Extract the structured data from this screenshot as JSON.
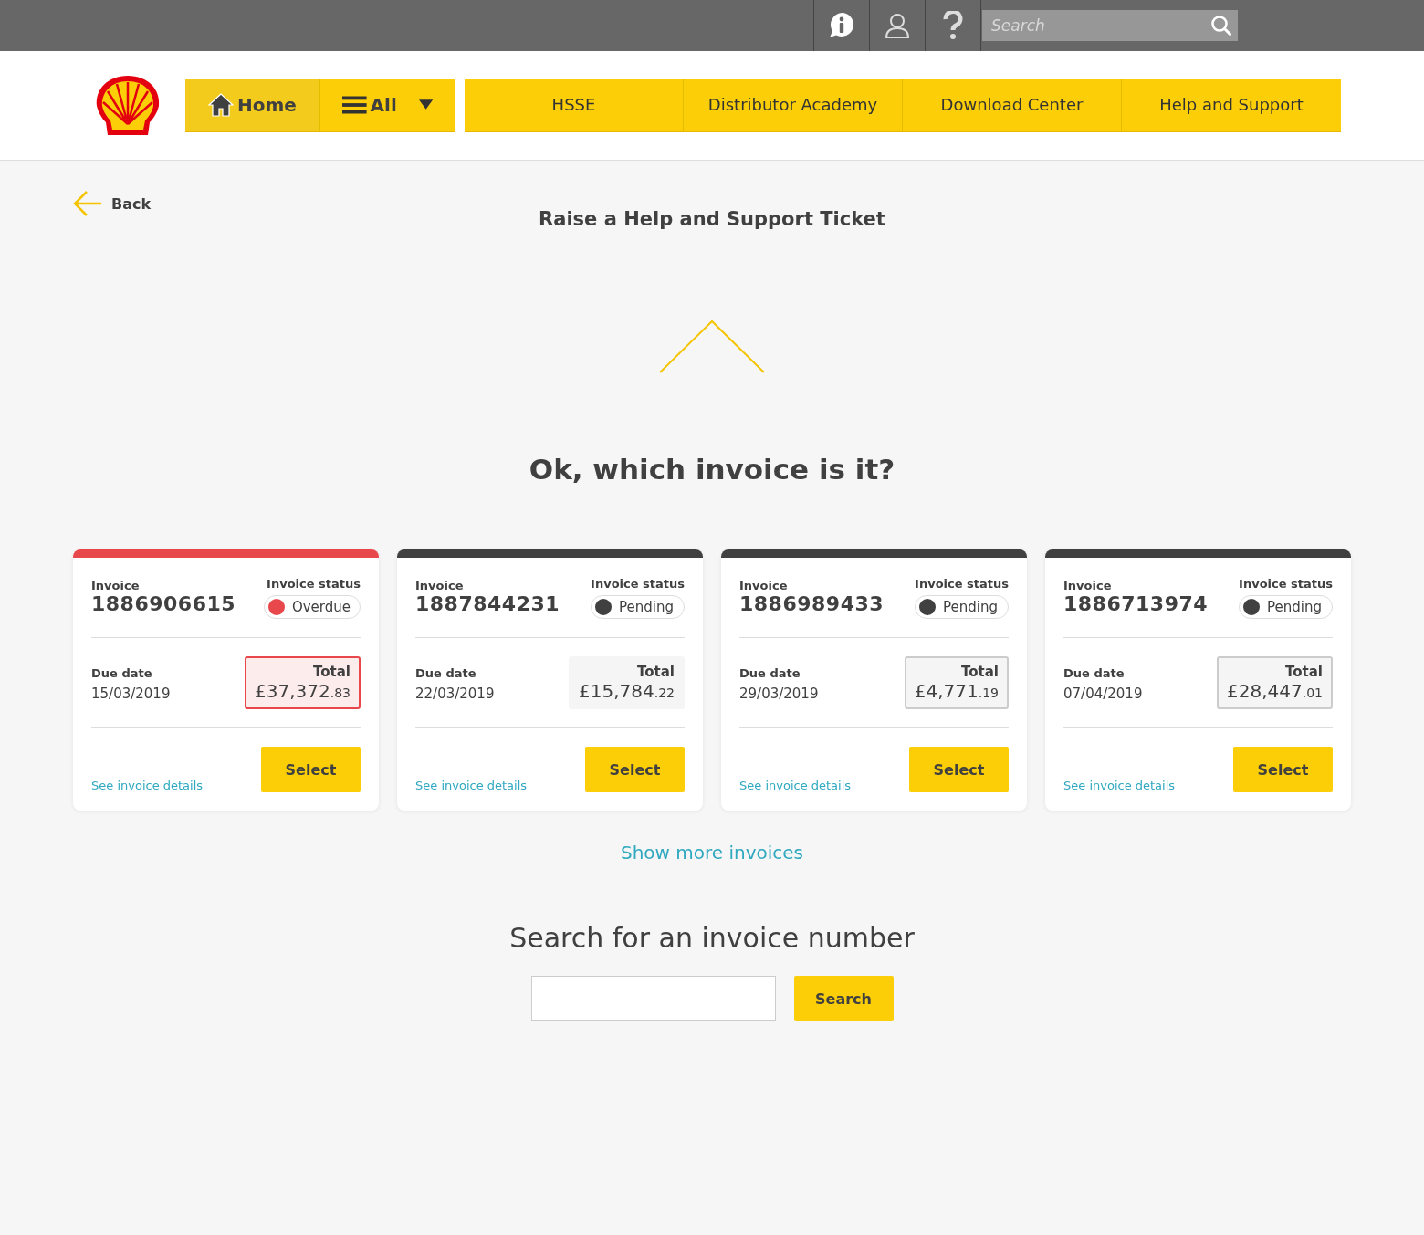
{
  "top_bar": {
    "search": {
      "placeholder": "Search"
    }
  },
  "nav": {
    "primary": [
      {
        "label": "Home",
        "kind": "home",
        "selected": true
      },
      {
        "label": "All",
        "kind": "menu",
        "selected": false
      }
    ],
    "items": [
      {
        "label": "HSSE"
      },
      {
        "label": "Distributor Academy"
      },
      {
        "label": "Download Center"
      },
      {
        "label": "Help and Support"
      }
    ]
  },
  "back": "Back",
  "page_title": "Raise a Help and Support Ticket",
  "question": "Ok, which invoice is it?",
  "invoices": [
    {
      "invoice_label": "Invoice",
      "number": "1886906615",
      "status_label": "Invoice status",
      "status": "Overdue",
      "kind": "overdue",
      "color": "#e8474c",
      "due_label": "Due date",
      "due": "15/03/2019",
      "total_label": "Total",
      "amount": "£37,372",
      "cents": ".83",
      "total_outlined": true,
      "link": "See invoice details",
      "button": "Select"
    },
    {
      "invoice_label": "Invoice",
      "number": "1887844231",
      "status_label": "Invoice status",
      "status": "Pending",
      "kind": "pending",
      "color": "#404040",
      "due_label": "Due date",
      "due": "22/03/2019",
      "total_label": "Total",
      "amount": "£15,784",
      "cents": ".22",
      "total_outlined": false,
      "link": "See invoice details",
      "button": "Select"
    },
    {
      "invoice_label": "Invoice",
      "number": "1886989433",
      "status_label": "Invoice status",
      "status": "Pending",
      "kind": "pending",
      "color": "#404040",
      "due_label": "Due date",
      "due": "29/03/2019",
      "total_label": "Total",
      "amount": "£4,771",
      "cents": ".19",
      "total_outlined": true,
      "link": "See invoice details",
      "button": "Select"
    },
    {
      "invoice_label": "Invoice",
      "number": "1886713974",
      "status_label": "Invoice status",
      "status": "Pending",
      "kind": "pending",
      "color": "#404040",
      "due_label": "Due date",
      "due": "07/04/2019",
      "total_label": "Total",
      "amount": "£28,447",
      "cents": ".01",
      "total_outlined": true,
      "link": "See invoice details",
      "button": "Select"
    }
  ],
  "show_more": "Show more invoices",
  "search_section": {
    "title": "Search for an invoice number",
    "button": "Search"
  }
}
